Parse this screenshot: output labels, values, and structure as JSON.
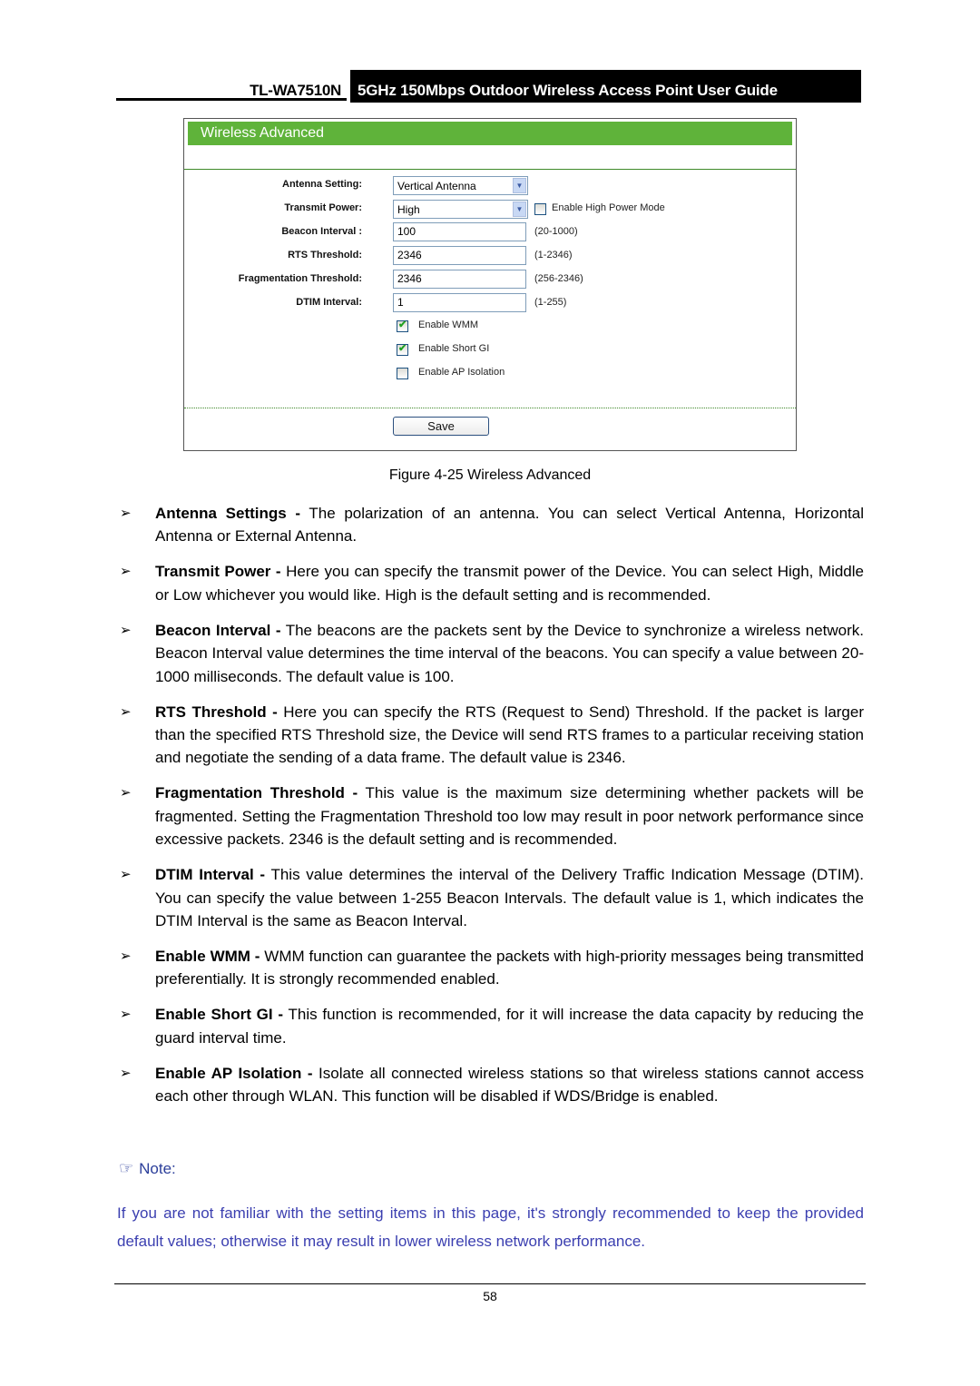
{
  "header": {
    "model": "TL-WA7510N",
    "title": "5GHz 150Mbps Outdoor Wireless Access Point User Guide"
  },
  "panel": {
    "title": "Wireless Advanced",
    "fields": [
      {
        "label": "Antenna Setting:",
        "value": "Vertical Antenna",
        "type": "select"
      },
      {
        "label": "Transmit Power:",
        "value": "High",
        "type": "select"
      },
      {
        "label": "Beacon Interval :",
        "value": "100",
        "hint": "(20-1000)"
      },
      {
        "label": "RTS Threshold:",
        "value": "2346",
        "hint": "(1-2346)"
      },
      {
        "label": "Fragmentation Threshold:",
        "value": "2346",
        "hint": "(256-2346)"
      },
      {
        "label": "DTIM Interval:",
        "value": "1",
        "hint": "(1-255)"
      }
    ],
    "high_power": {
      "label": "Enable High Power Mode",
      "checked": false
    },
    "checkboxes": [
      {
        "label": "Enable WMM",
        "checked": true
      },
      {
        "label": "Enable Short GI",
        "checked": true
      },
      {
        "label": "Enable AP Isolation",
        "checked": false
      }
    ],
    "save_label": "Save",
    "check_glyph": "✔",
    "arrow_glyph": "▼"
  },
  "caption": "Figure 4-25 Wireless Advanced",
  "bullet_glyph": "➢",
  "bullets": [
    {
      "term": "Antenna Settings -",
      "text": " The polarization of an antenna. You can select Vertical Antenna, Horizontal Antenna or External Antenna."
    },
    {
      "term": "Transmit Power -",
      "text": " Here you can specify the transmit power of the Device. You can select High, Middle or Low whichever you would like. High is the default setting and is recommended."
    },
    {
      "term": "Beacon Interval -",
      "text": " The beacons are the packets sent by the Device to synchronize a wireless network. Beacon Interval value determines the time interval of the beacons. You can specify a value between 20-1000 milliseconds. The default value is 100."
    },
    {
      "term": "RTS Threshold -",
      "text": " Here you can specify the RTS (Request to Send) Threshold. If the packet is larger than the specified RTS Threshold size, the Device will send RTS frames to a particular receiving station and negotiate the sending of a data frame. The default value is 2346."
    },
    {
      "term": "Fragmentation Threshold -",
      "text": " This value is the maximum size determining whether packets will be fragmented. Setting the Fragmentation Threshold too low may result in poor network performance since excessive packets. 2346 is the default setting and is recommended."
    },
    {
      "term": "DTIM Interval -",
      "text": " This value determines the interval of the Delivery Traffic Indication Message (DTIM). You can specify the value between 1-255 Beacon Intervals. The default value is 1, which indicates the DTIM Interval is the same as Beacon Interval."
    },
    {
      "term": "Enable WMM -",
      "text": " WMM function can guarantee the packets with high-priority messages being transmitted preferentially. It is strongly recommended enabled."
    },
    {
      "term": "Enable Short GI -",
      "text": " This function is recommended, for it will increase the data capacity by reducing the guard interval time."
    },
    {
      "term": "Enable AP Isolation -",
      "text": " Isolate all connected wireless stations so that wireless stations cannot access each other through WLAN. This function will be disabled if WDS/Bridge is enabled."
    }
  ],
  "note": {
    "icon": "☞",
    "label": "Note:",
    "text": "If you are not familiar with the setting items in this page, it's strongly recommended to keep the provided default values; otherwise it may result in lower wireless network performance."
  },
  "page_number": "58"
}
